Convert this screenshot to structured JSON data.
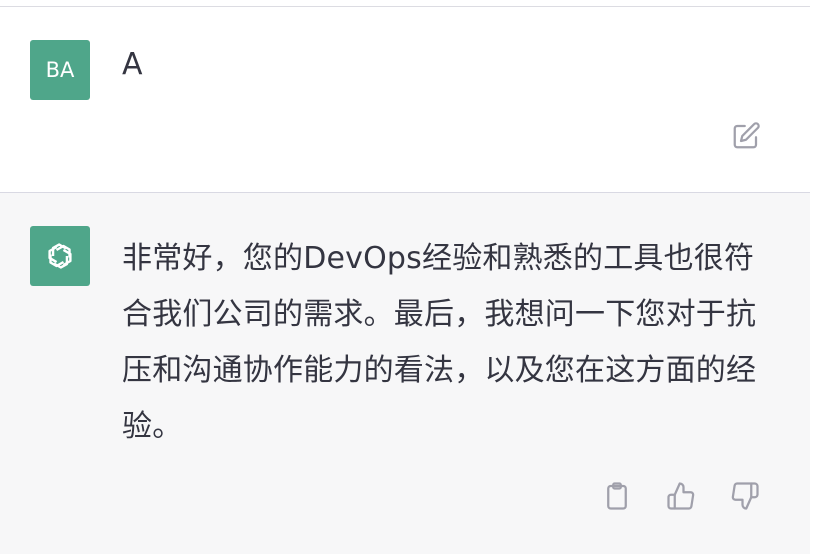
{
  "conversation": {
    "user_message": {
      "avatar_initials": "BA",
      "text": "A",
      "edit_icon": "edit-icon"
    },
    "assistant_message": {
      "avatar_icon": "openai-logo-icon",
      "text": "非常好，您的DevOps经验和熟悉的工具也很符合我们公司的需求。最后，我想问一下您对于抗压和沟通协作能力的看法，以及您在这方面的经验。",
      "actions": [
        "copy-icon",
        "thumbs-up-icon",
        "thumbs-down-icon"
      ]
    }
  },
  "colors": {
    "avatar_bg": "#4fa68a",
    "assistant_bg": "#f7f7f8",
    "text": "#343541",
    "icon": "#a0a0ab"
  }
}
